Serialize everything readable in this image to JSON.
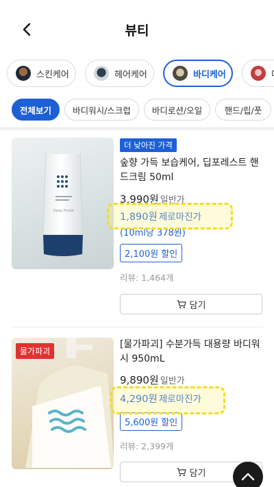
{
  "header": {
    "title": "뷰티"
  },
  "categories": [
    {
      "label": "스킨케어",
      "active": false
    },
    {
      "label": "헤어케어",
      "active": false
    },
    {
      "label": "바디케어",
      "active": true
    },
    {
      "label": "더",
      "active": false
    }
  ],
  "subcategories": [
    {
      "label": "전체보기",
      "active": true
    },
    {
      "label": "바디워시/스크럽",
      "active": false
    },
    {
      "label": "바디로션/오일",
      "active": false
    },
    {
      "label": "핸드/립/풋",
      "active": false
    }
  ],
  "products": [
    {
      "badge": "더 낮아진 가격",
      "name": "숲향 가득 보습케어, 딥포레스트 핸드크림 50ml",
      "price": "3,990원",
      "price_label": "일반가",
      "zero_price": "1,890원",
      "zero_label": "제로마진가",
      "unit_price": "(10ml당 378원)",
      "discount": "2,100원 할인",
      "review": "리뷰: 1,464개",
      "cart_label": "담기",
      "tube_text": "Deep Forest"
    },
    {
      "badge": "물가파괴",
      "name": "[물가파괴] 수분가득 대용량 바디워시 950mL",
      "price": "9,890원",
      "price_label": "일반가",
      "zero_price": "4,290원",
      "zero_label": "제로마진가",
      "discount": "5,600원 할인",
      "review": "리뷰: 2,399개",
      "cart_label": "담기"
    }
  ]
}
